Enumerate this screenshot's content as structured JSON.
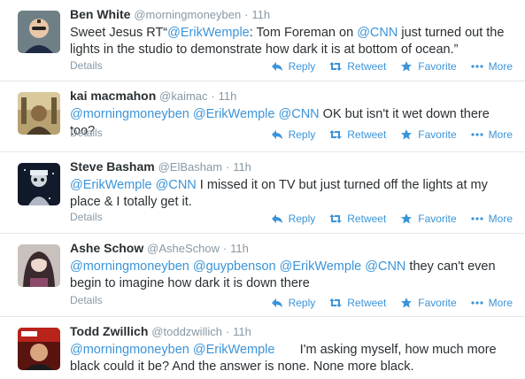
{
  "actions": {
    "reply": "Reply",
    "retweet": "Retweet",
    "favorite": "Favorite",
    "more": "More",
    "details": "Details"
  },
  "tweets": [
    {
      "fullname": "Ben White",
      "handle": "@morningmoneyben",
      "dot": "·",
      "time": "11h",
      "text_parts": [
        "Sweet Jesus RT“",
        "@ErikWemple",
        ": Tom Foreman on ",
        "@CNN",
        " just turned out the lights in the studio to demonstrate how dark it is at bottom of ocean.”"
      ]
    },
    {
      "fullname": "kai macmahon",
      "handle": "@kaimac",
      "dot": "·",
      "time": "11h",
      "text_parts": [
        "@morningmoneyben",
        " ",
        "@ErikWemple",
        " ",
        "@CNN",
        " OK but isn't it wet down there too?"
      ]
    },
    {
      "fullname": "Steve Basham",
      "handle": "@ElBasham",
      "dot": "·",
      "time": "11h",
      "text_parts": [
        "@ErikWemple",
        " ",
        "@CNN",
        " I missed it on TV but just turned off the lights at my place & I totally get it."
      ]
    },
    {
      "fullname": "Ashe Schow",
      "handle": "@AsheSchow",
      "dot": "·",
      "time": "11h",
      "text_parts": [
        "@morningmoneyben",
        " ",
        "@guypbenson",
        " ",
        "@ErikWemple",
        " ",
        "@CNN",
        " they can't even begin to imagine how dark it is down there"
      ]
    },
    {
      "fullname": "Todd Zwillich",
      "handle": "@toddzwillich",
      "dot": "·",
      "time": "11h",
      "text_parts": [
        "@morningmoneyben",
        " ",
        "@ErikWemple",
        "       I'm asking myself, how much more black could it be? And the answer is none. None more black."
      ]
    }
  ]
}
